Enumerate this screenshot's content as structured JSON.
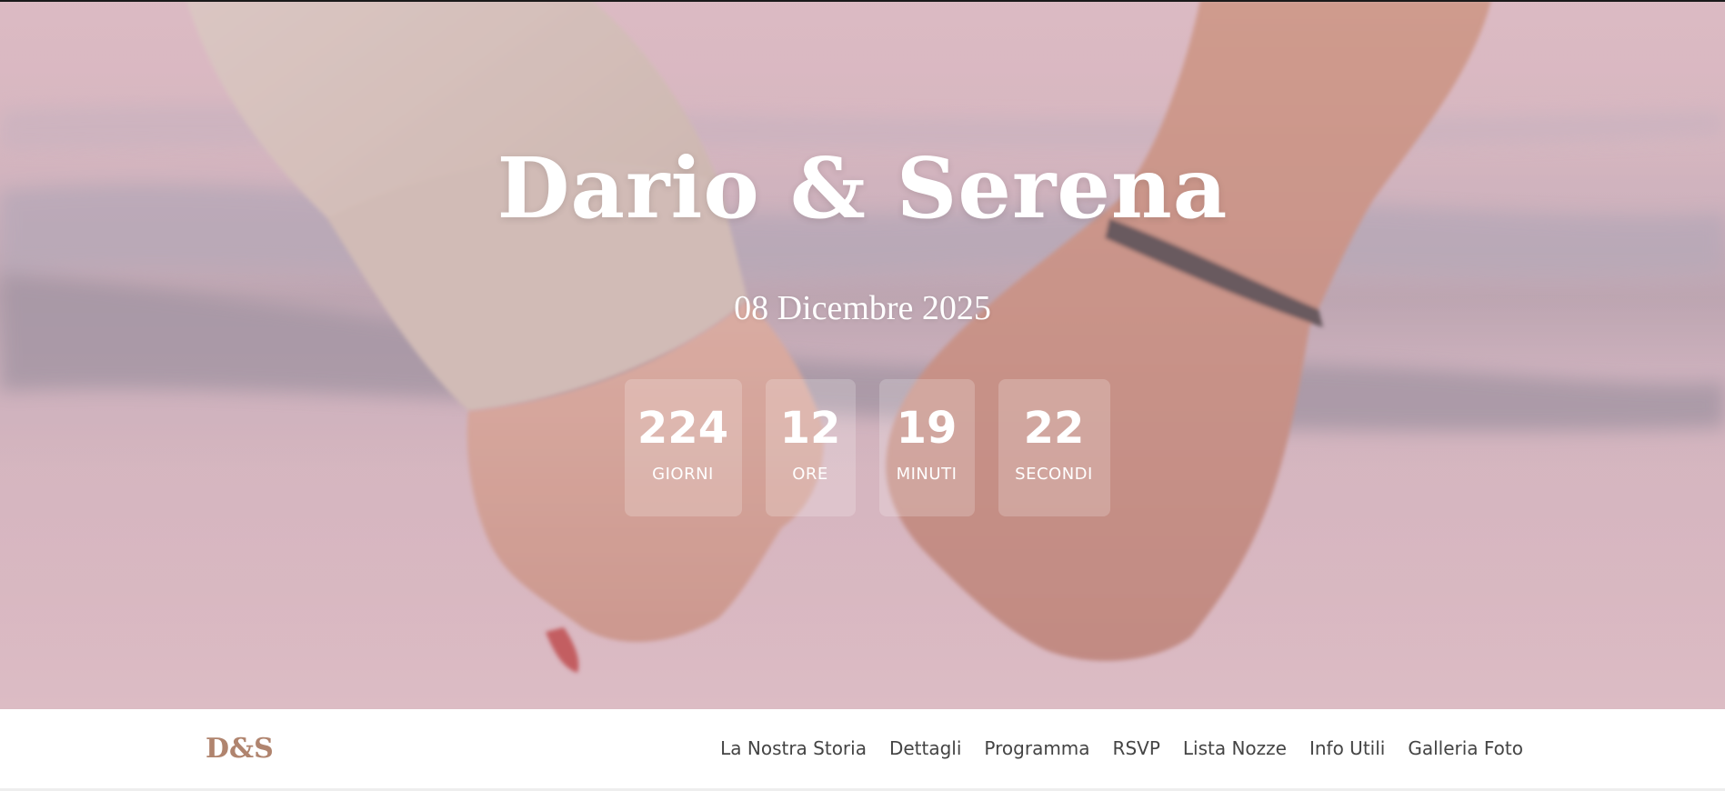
{
  "hero": {
    "title": "Dario & Serena",
    "date": "08 Dicembre 2025",
    "background_image": "couple-holding-hands-photo",
    "overlay_color": "#e1b9c6"
  },
  "countdown": [
    {
      "value": "224",
      "label": "GIORNI"
    },
    {
      "value": "12",
      "label": "ORE"
    },
    {
      "value": "19",
      "label": "MINUTI"
    },
    {
      "value": "22",
      "label": "SECONDI"
    }
  ],
  "nav": {
    "brand": "D&S",
    "links": [
      "La Nostra Storia",
      "Dettagli",
      "Programma",
      "RSVP",
      "Lista Nozze",
      "Info Utili",
      "Galleria Foto"
    ]
  },
  "colors": {
    "brand": "#b0846e",
    "nav_text": "#444444",
    "hero_text": "#ffffff"
  }
}
